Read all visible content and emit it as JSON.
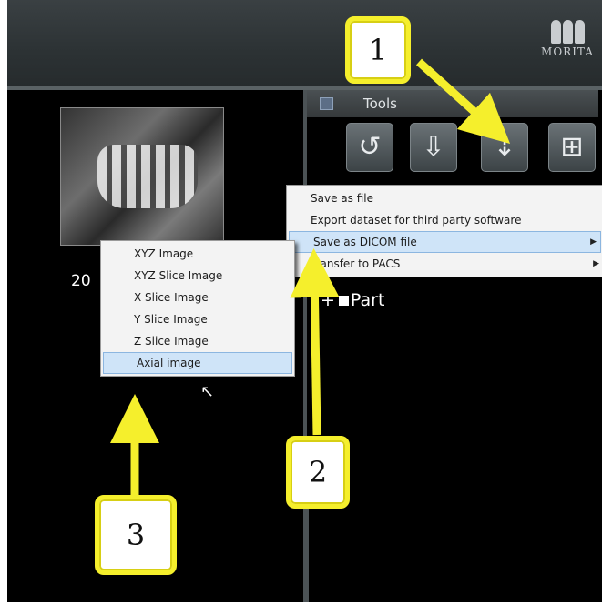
{
  "brand": {
    "logo_text": "MORITA"
  },
  "tools": {
    "title": "Tools",
    "buttons": [
      "rotate-icon",
      "import-icon",
      "save-export-icon",
      "layout-icon"
    ]
  },
  "thumbnail": {
    "caption": "20"
  },
  "tree": {
    "node_label": "Part"
  },
  "save_menu": {
    "items": [
      {
        "label": "Save as file",
        "has_submenu": false,
        "highlighted": false
      },
      {
        "label": "Export dataset for third party software",
        "has_submenu": false,
        "highlighted": false
      },
      {
        "label": "Save as DICOM file",
        "has_submenu": true,
        "highlighted": true
      },
      {
        "label": "Transfer to PACS",
        "has_submenu": true,
        "highlighted": false
      }
    ]
  },
  "dicom_submenu": {
    "items": [
      {
        "label": "XYZ Image",
        "highlighted": false
      },
      {
        "label": "XYZ Slice Image",
        "highlighted": false
      },
      {
        "label": "X Slice Image",
        "highlighted": false
      },
      {
        "label": "Y Slice Image",
        "highlighted": false
      },
      {
        "label": "Z Slice Image",
        "highlighted": false
      },
      {
        "label": "Axial image",
        "highlighted": true
      }
    ]
  },
  "callouts": [
    {
      "number": "1",
      "target": "save-export-button"
    },
    {
      "number": "2",
      "target": "save-as-dicom-item"
    },
    {
      "number": "3",
      "target": "axial-image-item"
    }
  ],
  "colors": {
    "callout_yellow": "#f5ef2c",
    "highlight": "#cfe4f8",
    "background": "#000000"
  }
}
